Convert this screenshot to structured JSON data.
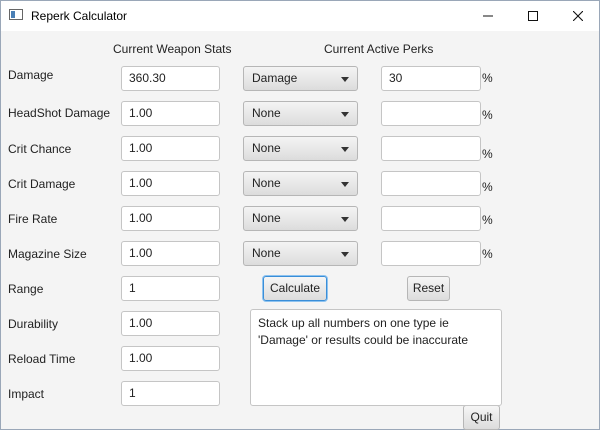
{
  "window": {
    "title": "Reperk Calculator",
    "minimize_icon": "minimize-icon",
    "maximize_icon": "maximize-icon",
    "close_icon": "close-icon"
  },
  "headings": {
    "weapon_stats": "Current Weapon Stats",
    "active_perks": "Current Active Perks"
  },
  "stats": [
    {
      "label": "Damage",
      "value": "360.30"
    },
    {
      "label": "HeadShot  Damage",
      "value": "1.00"
    },
    {
      "label": "Crit Chance",
      "value": "1.00"
    },
    {
      "label": "Crit Damage",
      "value": "1.00"
    },
    {
      "label": "Fire Rate",
      "value": "1.00"
    },
    {
      "label": "Magazine Size",
      "value": "1.00"
    },
    {
      "label": "Range",
      "value": "1"
    },
    {
      "label": "Durability",
      "value": "1.00"
    },
    {
      "label": "Reload Time",
      "value": "1.00"
    },
    {
      "label": "Impact",
      "value": "1"
    }
  ],
  "perks": [
    {
      "selected": "Damage",
      "value": "30",
      "unit": "%"
    },
    {
      "selected": "None",
      "value": "",
      "unit": "%"
    },
    {
      "selected": "None",
      "value": "",
      "unit": "%"
    },
    {
      "selected": "None",
      "value": "",
      "unit": "%"
    },
    {
      "selected": "None",
      "value": "",
      "unit": "%"
    },
    {
      "selected": "None",
      "value": "",
      "unit": "%"
    }
  ],
  "buttons": {
    "calculate": "Calculate",
    "reset": "Reset",
    "quit": "Quit"
  },
  "output": {
    "text": "Stack up all numbers on one type ie\n'Damage' or results could be inaccurate"
  }
}
